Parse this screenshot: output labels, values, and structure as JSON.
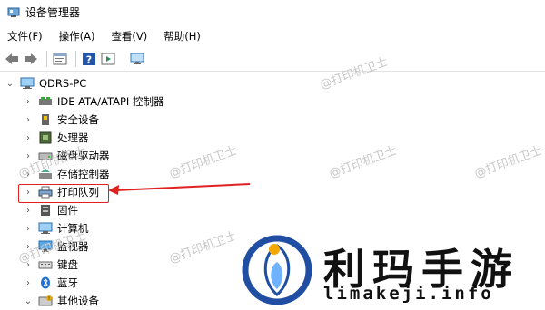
{
  "window": {
    "title": "设备管理器"
  },
  "menu": {
    "items": [
      "文件(F)",
      "操作(A)",
      "查看(V)",
      "帮助(H)"
    ]
  },
  "toolbar": {
    "buttons": [
      "back-icon",
      "forward-icon",
      "properties-icon",
      "help-icon",
      "run-icon",
      "monitor-icon"
    ]
  },
  "tree": {
    "root": "QDRS-PC",
    "items": [
      {
        "label": "IDE ATA/ATAPI 控制器",
        "icon": "ide-controller-icon"
      },
      {
        "label": "安全设备",
        "icon": "security-device-icon"
      },
      {
        "label": "处理器",
        "icon": "processor-icon"
      },
      {
        "label": "磁盘驱动器",
        "icon": "disk-drive-icon"
      },
      {
        "label": "存储控制器",
        "icon": "storage-controller-icon"
      },
      {
        "label": "打印队列",
        "icon": "print-queue-icon"
      },
      {
        "label": "固件",
        "icon": "firmware-icon"
      },
      {
        "label": "计算机",
        "icon": "computer-icon"
      },
      {
        "label": "监视器",
        "icon": "monitor-icon"
      },
      {
        "label": "键盘",
        "icon": "keyboard-icon"
      },
      {
        "label": "蓝牙",
        "icon": "bluetooth-icon"
      },
      {
        "label": "其他设备",
        "icon": "other-devices-icon"
      }
    ]
  },
  "watermark": {
    "text": "@打印机卫士"
  },
  "logo": {
    "cn": "利玛手游",
    "en": "limakeji.info"
  },
  "colors": {
    "accent_red": "#e02020",
    "logo_blue": "#1f4ea3",
    "logo_gold": "#f2a800"
  }
}
